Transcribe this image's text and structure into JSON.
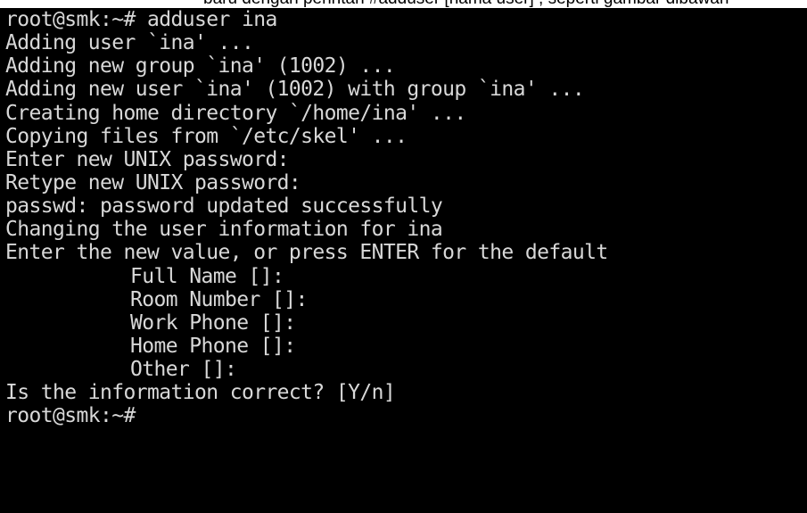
{
  "caption": {
    "clipped_text": "baru dengan perintah #adduser [nama user] , seperti gambar dibawah"
  },
  "terminal": {
    "lines": [
      "root@smk:~# adduser ina",
      "Adding user `ina' ...",
      "Adding new group `ina' (1002) ...",
      "Adding new user `ina' (1002) with group `ina' ...",
      "Creating home directory `/home/ina' ...",
      "Copying files from `/etc/skel' ...",
      "Enter new UNIX password:",
      "Retype new UNIX password:",
      "passwd: password updated successfully",
      "Changing the user information for ina",
      "Enter the new value, or press ENTER for the default",
      "Full Name []:",
      "Room Number []:",
      "Work Phone []:",
      "Home Phone []:",
      "Other []:",
      "Is the information correct? [Y/n]",
      "root@smk:~#"
    ]
  },
  "colors": {
    "background": "#000000",
    "text": "#d8d8d8"
  }
}
